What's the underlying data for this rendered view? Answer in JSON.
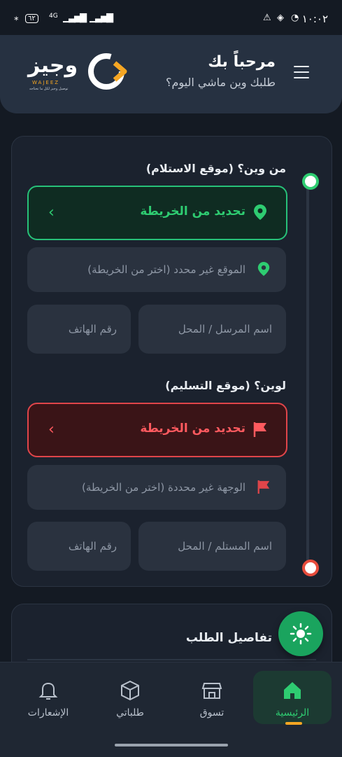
{
  "status_bar": {
    "time": "١٠:٠٢",
    "battery": "٦٢",
    "network": "4G"
  },
  "header": {
    "greeting": "مرحباً بك",
    "subtitle": "طلبك وين ماشي اليوم؟",
    "logo_text": "وجيز",
    "logo_sub": "WAJEEZ",
    "logo_tagline": "توصيل وجيز لكل ما تحتاجه"
  },
  "pickup": {
    "title": "من وين؟ (موقع الاستلام)",
    "map_button": "تحديد من الخريطة",
    "location_placeholder": "الموقع غير محدد (اختر من الخريطة)",
    "name_placeholder": "اسم المرسل / المحل",
    "phone_placeholder": "رقم الهاتف"
  },
  "dropoff": {
    "title": "لوين؟ (موقع التسليم)",
    "map_button": "تحديد من الخريطة",
    "location_placeholder": "الوجهة غير محددة (اختر من الخريطة)",
    "name_placeholder": "اسم المستلم / المحل",
    "phone_placeholder": "رقم الهاتف"
  },
  "details": {
    "title": "تفاصيل الطلب"
  },
  "nav": {
    "items": [
      {
        "label": "الرئيسية",
        "icon": "home-icon",
        "active": true
      },
      {
        "label": "تسوق",
        "icon": "store-icon",
        "active": false
      },
      {
        "label": "طلباتي",
        "icon": "box-icon",
        "active": false
      },
      {
        "label": "الإشعارات",
        "icon": "bell-icon",
        "active": false
      }
    ]
  },
  "colors": {
    "accent_green": "#2ecc71",
    "accent_red": "#ff5a5f",
    "brand_orange": "#f5a623"
  }
}
